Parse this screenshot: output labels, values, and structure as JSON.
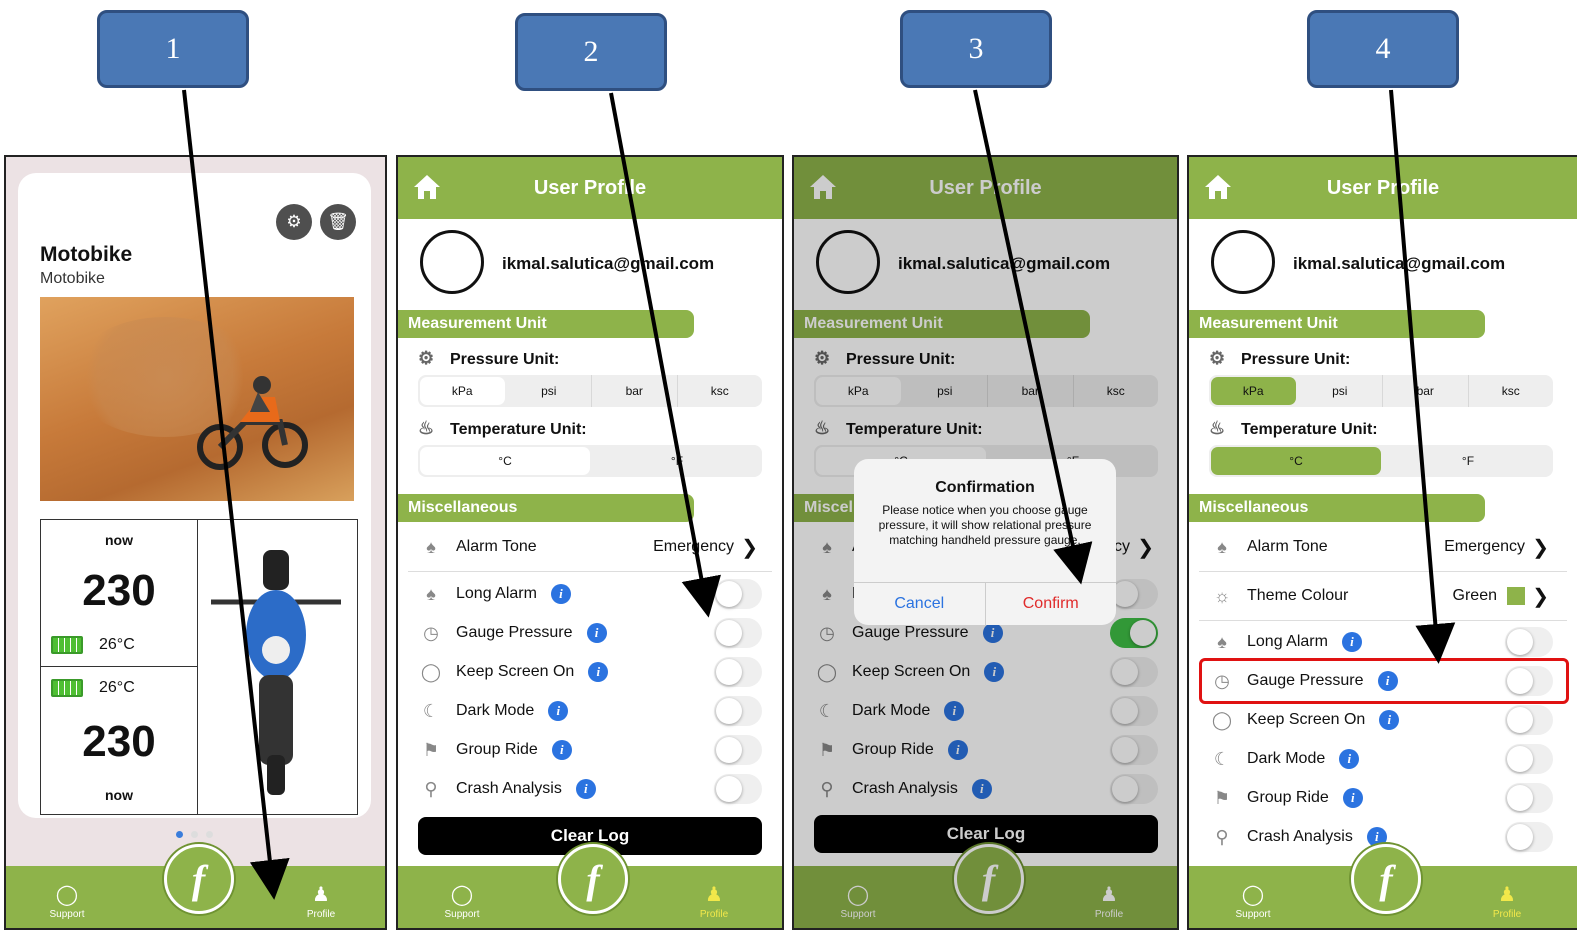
{
  "steps": [
    "1",
    "2",
    "3",
    "4"
  ],
  "vehicle": {
    "title": "Motobike",
    "subtitle": "Motobike",
    "front": {
      "pressure": "230",
      "temp": "26°C",
      "time": "now"
    },
    "rear": {
      "pressure": "230",
      "temp": "26°C",
      "time": "now"
    },
    "page_dots": 3,
    "active_dot": 0
  },
  "nav": {
    "support": "Support",
    "profile": "Profile",
    "logo_letter": "f"
  },
  "profile": {
    "title": "User Profile",
    "email": "ikmal.salutica@gmail.com",
    "measurement_header": "Measurement Unit",
    "pressure_label": "Pressure Unit:",
    "pressure_options": [
      "kPa",
      "psi",
      "bar",
      "ksc"
    ],
    "temperature_label": "Temperature Unit:",
    "temperature_options": [
      "°C",
      "°F"
    ],
    "misc_header": "Miscellaneous",
    "alarm_tone_label": "Alarm Tone",
    "alarm_tone_value": "Emergency",
    "theme_label": "Theme Colour",
    "theme_value": "Green",
    "toggles": [
      "Long Alarm",
      "Gauge Pressure",
      "Keep Screen On",
      "Dark Mode",
      "Group Ride",
      "Crash Analysis"
    ],
    "clear_log": "Clear Log"
  },
  "dialog": {
    "title": "Confirmation",
    "message": "Please notice when you choose gauge pressure, it will show relational pressure matching handheld pressure gauge.",
    "cancel": "Cancel",
    "confirm": "Confirm"
  },
  "colors": {
    "accent": "#8eb34a",
    "info": "#2b73e0",
    "toggle_on": "#3fbe45",
    "highlight": "#e01212",
    "step_box": "#4a78b5"
  },
  "icons": {
    "home": "home-icon",
    "wrench": "wrench-icon",
    "trash": "trash-icon",
    "gauge": "gauge-icon",
    "thermometer": "thermometer-icon",
    "bell": "bell-icon",
    "palette": "palette-icon",
    "bulb": "bulb-icon",
    "moon": "moon-icon",
    "group": "group-icon",
    "search": "search-icon",
    "headset": "headset-icon",
    "person": "person-icon"
  }
}
